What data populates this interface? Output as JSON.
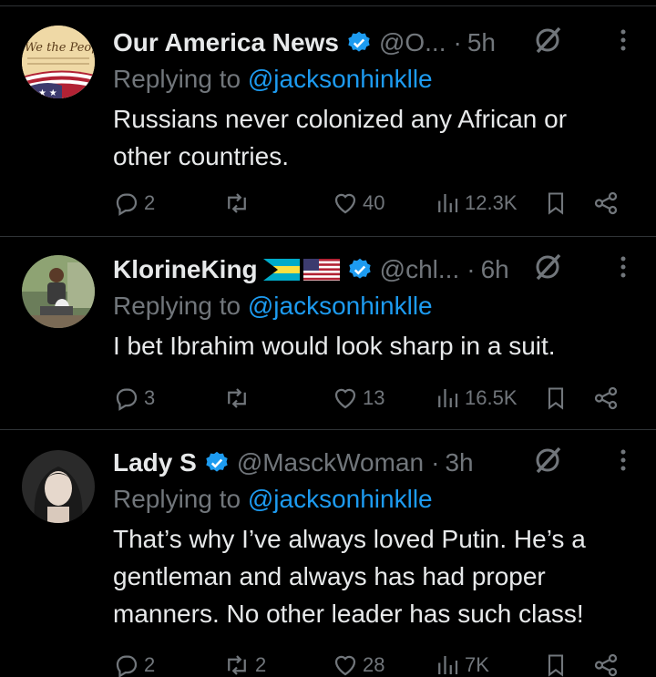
{
  "tweets": [
    {
      "name": "Our America News",
      "handle": "@O...",
      "dot": "·",
      "time": "5h",
      "replying_prefix": "Replying to",
      "replying_to": "@jacksonhinklle",
      "text": "Russians never colonized any African or other countries.",
      "replies": "2",
      "reposts": "",
      "likes": "40",
      "views": "12.3K",
      "avatar_text": "We the People"
    },
    {
      "name": "KlorineKing",
      "handle": "@chl...",
      "dot": "·",
      "time": "6h",
      "replying_prefix": "Replying to",
      "replying_to": "@jacksonhinklle",
      "text": "I bet Ibrahim would look sharp in a suit.",
      "replies": "3",
      "reposts": "",
      "likes": "13",
      "views": "16.5K"
    },
    {
      "name": "Lady S",
      "handle": "@MasckWoman",
      "dot": "·",
      "time": "3h",
      "replying_prefix": "Replying to",
      "replying_to": "@jacksonhinklle",
      "text": "That’s why I’ve always loved Putin. He’s a gentleman and always has had proper manners. No other leader has such class!",
      "replies": "2",
      "reposts": "2",
      "likes": "28",
      "views": "7K"
    }
  ],
  "colors": {
    "background": "#000000",
    "text": "#e7e9ea",
    "muted": "#71767b",
    "link": "#1d9bf0",
    "verified": "#1d9bf0",
    "divider": "#2f3336"
  },
  "icons": [
    "verified-badge-icon",
    "grok-icon",
    "more-icon",
    "reply-icon",
    "repost-icon",
    "like-icon",
    "views-icon",
    "bookmark-icon",
    "share-icon"
  ]
}
